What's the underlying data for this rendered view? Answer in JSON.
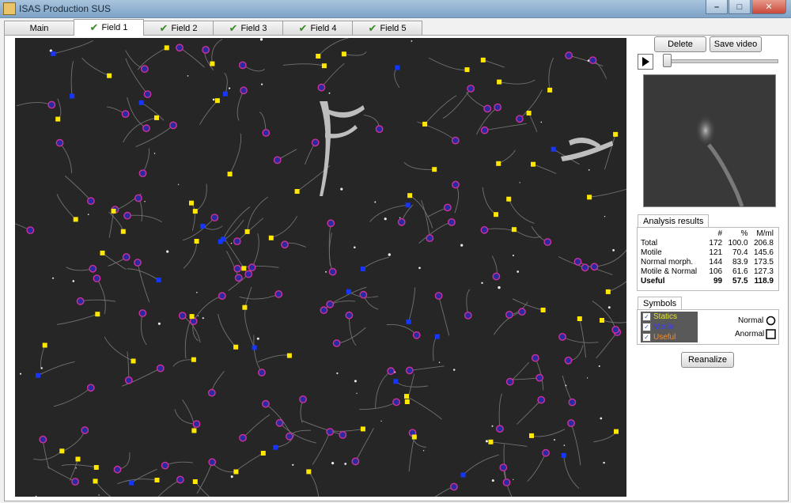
{
  "window": {
    "title": "ISAS Production SUS"
  },
  "tabs": [
    {
      "label": "Main",
      "checked": false
    },
    {
      "label": "Field 1",
      "checked": true,
      "active": true
    },
    {
      "label": "Field 2",
      "checked": true
    },
    {
      "label": "Field 3",
      "checked": true
    },
    {
      "label": "Field 4",
      "checked": true
    },
    {
      "label": "Field 5",
      "checked": true
    }
  ],
  "toolbar": {
    "delete_label": "Delete",
    "save_video_label": "Save video"
  },
  "results": {
    "tab_label": "Analysis results",
    "headers": [
      "",
      "#",
      "%",
      "M/ml"
    ],
    "rows": [
      {
        "label": "Total",
        "count": "172",
        "percent": "100.0",
        "mml": "206.8"
      },
      {
        "label": "Motile",
        "count": "121",
        "percent": "70.4",
        "mml": "145.6"
      },
      {
        "label": "Normal morph.",
        "count": "144",
        "percent": "83.9",
        "mml": "173.5"
      },
      {
        "label": "Motile & Normal",
        "count": "106",
        "percent": "61.6",
        "mml": "127.3"
      },
      {
        "label": "Useful",
        "count": "99",
        "percent": "57.5",
        "mml": "118.9"
      }
    ]
  },
  "symbols": {
    "tab_label": "Symbols",
    "items": [
      {
        "label": "Statics",
        "color": "#e6e62a",
        "checked": true
      },
      {
        "label": "Motile",
        "color": "#3030ff",
        "checked": true
      },
      {
        "label": "Useful",
        "color": "#ff8c1a",
        "checked": true
      }
    ],
    "normal_label": "Normal",
    "anormal_label": "Anormal"
  },
  "reanalize_label": "Reanalize",
  "colors": {
    "static": "#ffe800",
    "motile": "#1436ff",
    "useful_ring": "#d0309a",
    "useful_fill": "#2a2aa0",
    "background": "#262626"
  }
}
